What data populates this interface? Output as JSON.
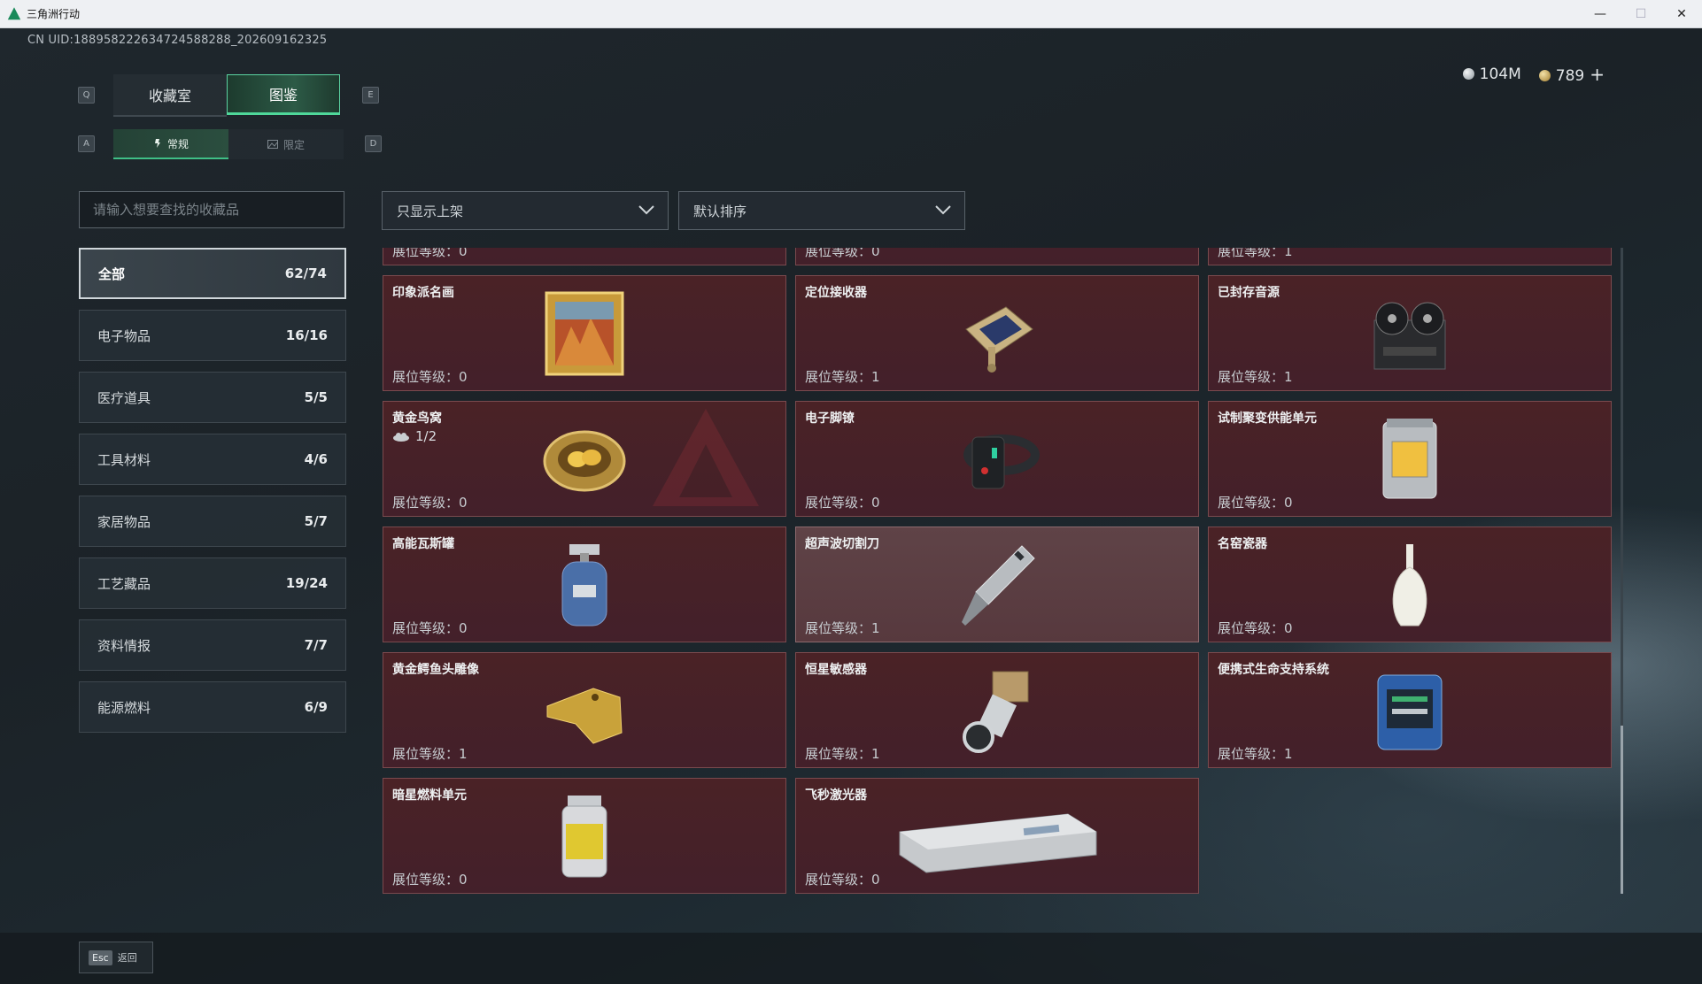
{
  "window": {
    "title": "三角洲行动",
    "minimize": "—",
    "maximize": "☐",
    "close": "✕"
  },
  "uid": "CN UID:1889582226347245882​88_202609162325",
  "currency": {
    "silver": "104M",
    "gold": "789",
    "add": "+"
  },
  "keys": {
    "prev_tab": "Q",
    "next_tab": "E",
    "prev_sub": "A",
    "next_sub": "D"
  },
  "tabs": [
    {
      "label": "收藏室"
    },
    {
      "label": "图鉴"
    }
  ],
  "subtabs": [
    {
      "label": "常规"
    },
    {
      "label": "限定"
    }
  ],
  "search": {
    "placeholder": "请输入想要查找的收藏品",
    "value": ""
  },
  "filters": {
    "shelf": "只显示上架",
    "sort": "默认排序"
  },
  "categories": [
    {
      "label": "全部",
      "count": "62/74"
    },
    {
      "label": "电子物品",
      "count": "16/16"
    },
    {
      "label": "医疗道具",
      "count": "5/5"
    },
    {
      "label": "工具材料",
      "count": "4/6"
    },
    {
      "label": "家居物品",
      "count": "5/7"
    },
    {
      "label": "工艺藏品",
      "count": "19/24"
    },
    {
      "label": "资料情报",
      "count": "7/7"
    },
    {
      "label": "能源燃料",
      "count": "6/9"
    }
  ],
  "level_label": "展位等级：",
  "items": [
    {
      "name": "",
      "level": "0",
      "icon": "partial-item-icon"
    },
    {
      "name": "",
      "level": "0",
      "icon": "partial-item-icon"
    },
    {
      "name": "",
      "level": "1",
      "icon": "partial-item-icon"
    },
    {
      "name": "印象派名画",
      "level": "0",
      "icon": "framed-painting-icon"
    },
    {
      "name": "定位接收器",
      "level": "1",
      "icon": "gps-receiver-icon"
    },
    {
      "name": "已封存音源",
      "level": "1",
      "icon": "reel-recorder-icon"
    },
    {
      "name": "黄金鸟窝",
      "level": "0",
      "icon": "golden-nest-icon",
      "sub": "1/2"
    },
    {
      "name": "电子脚镣",
      "level": "0",
      "icon": "ankle-monitor-icon"
    },
    {
      "name": "试制聚变供能单元",
      "level": "0",
      "icon": "fusion-cell-icon"
    },
    {
      "name": "高能瓦斯罐",
      "level": "0",
      "icon": "gas-canister-icon"
    },
    {
      "name": "超声波切割刀",
      "level": "1",
      "icon": "ultrasonic-cutter-icon"
    },
    {
      "name": "名窑瓷器",
      "level": "0",
      "icon": "porcelain-vase-icon"
    },
    {
      "name": "黄金鳄鱼头雕像",
      "level": "1",
      "icon": "gold-crocodile-icon"
    },
    {
      "name": "恒星敏感器",
      "level": "1",
      "icon": "star-sensor-icon"
    },
    {
      "name": "便携式生命支持系统",
      "level": "1",
      "icon": "life-support-icon"
    },
    {
      "name": "暗星燃料单元",
      "level": "0",
      "icon": "fuel-cell-icon"
    },
    {
      "name": "飞秒激光器",
      "level": "0",
      "icon": "femtosecond-laser-icon"
    }
  ],
  "footer": {
    "esc_key": "Esc",
    "back": "返回"
  }
}
